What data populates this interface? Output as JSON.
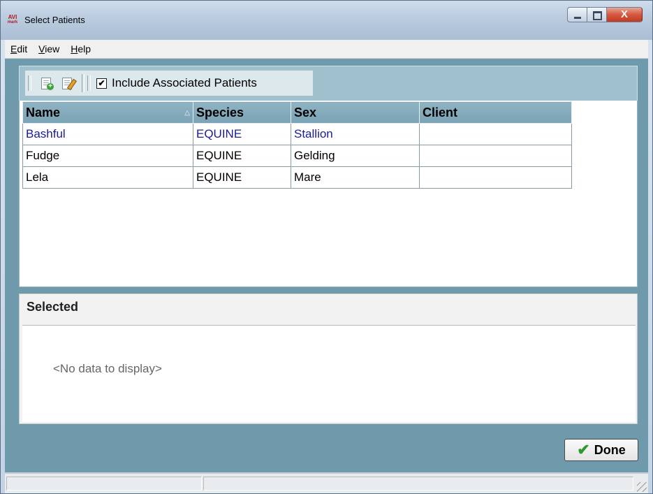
{
  "window": {
    "title": "Select Patients",
    "app_icon_text": "AVI",
    "app_icon_sub": "mark",
    "close_glyph": "X"
  },
  "menu": {
    "items": [
      {
        "accel": "E",
        "rest": "dit"
      },
      {
        "accel": "V",
        "rest": "iew"
      },
      {
        "accel": "H",
        "rest": "elp"
      }
    ]
  },
  "toolbar": {
    "new_icon": "new-document-icon",
    "edit_icon": "edit-document-icon",
    "include_associated": {
      "label": "Include Associated Patients",
      "checked": true,
      "check_glyph": "✔"
    }
  },
  "grid": {
    "columns": [
      "Name",
      "Species",
      "Sex",
      "Client"
    ],
    "sort_glyph": "△",
    "rows": [
      {
        "name": "Bashful",
        "species": "EQUINE",
        "sex": "Stallion",
        "client": ""
      },
      {
        "name": "Fudge",
        "species": "EQUINE",
        "sex": "Gelding",
        "client": ""
      },
      {
        "name": "Lela",
        "species": "EQUINE",
        "sex": "Mare",
        "client": ""
      }
    ],
    "selected_row": 0
  },
  "selected_panel": {
    "title": "Selected",
    "empty_text": "<No data to display>"
  },
  "done_button": {
    "label": "Done",
    "icon": "checkmark-icon",
    "glyph": "✔"
  },
  "colors": {
    "selected_text": "#1a1a9e",
    "header_bg": "#7aa3b5",
    "client_bg": "#6e9aac"
  }
}
